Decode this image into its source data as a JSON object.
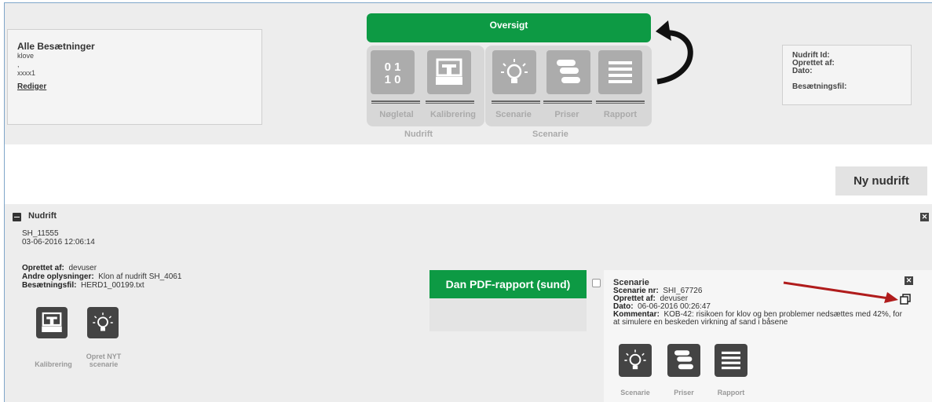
{
  "herd": {
    "title": "Alle Besætninger",
    "line1": "klove",
    "line2": ",",
    "line3": "xxxx1",
    "edit_link": "Rediger"
  },
  "nav": {
    "oversigt": "Oversigt",
    "tiles": [
      {
        "label": "Nøgletal",
        "icon": "binary-icon"
      },
      {
        "label": "Kalibrering",
        "icon": "calibration-icon"
      },
      {
        "label": "Scenarie",
        "icon": "lightbulb-icon"
      },
      {
        "label": "Priser",
        "icon": "coins-icon"
      },
      {
        "label": "Rapport",
        "icon": "list-icon"
      }
    ],
    "group_nudrift": "Nudrift",
    "group_scenarie": "Scenarie"
  },
  "info": {
    "nudrift_id": "Nudrift Id:",
    "oprettet_af": "Oprettet af:",
    "dato": "Dato:",
    "besaetningsfil": "Besætningsfil:"
  },
  "ny_nudrift": "Ny nudrift",
  "nudrift": {
    "title": "Nudrift",
    "id": "SH_11555",
    "timestamp": "03-06-2016 12:06:14",
    "oprettet_af_label": "Oprettet af:",
    "oprettet_af": "devuser",
    "andre_label": "Andre oplysninger:",
    "andre": "Klon af nudrift SH_4061",
    "fil_label": "Besætningsfil:",
    "fil": "HERD1_00199.txt",
    "action_kalibrering": "Kalibrering",
    "action_opret_1": "Opret NYT",
    "action_opret_2": "scenarie"
  },
  "pdf_button": "Dan PDF-rapport (sund)",
  "scenarie": {
    "title": "Scenarie",
    "nr_label": "Scenarie nr:",
    "nr": "SHI_67726",
    "oprettet_label": "Oprettet af:",
    "oprettet": "devuser",
    "dato_label": "Dato:",
    "dato": "06-06-2016 00:26:47",
    "kommentar_label": "Kommentar:",
    "kommentar_1": "KOB-42: risikoen for klov og ben problemer nedsættes med 42%, for",
    "kommentar_2": "at simulere en beskeden virkning af sand i båsene",
    "actions": [
      "Scenarie",
      "Priser",
      "Rapport"
    ]
  },
  "colors": {
    "accent_green": "#0d9a44",
    "arrow_red": "#b01c1c"
  }
}
